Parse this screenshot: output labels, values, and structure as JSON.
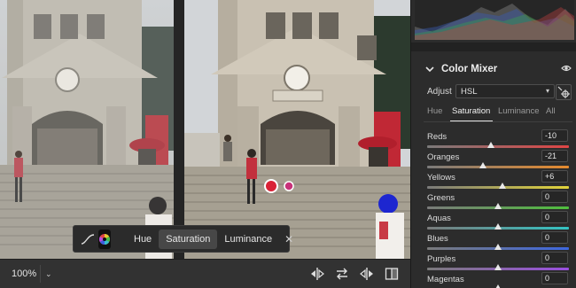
{
  "float_toolbar": {
    "curve_icon": "curve-icon",
    "color_icon": "color-wheel-icon",
    "tabs": [
      "Hue",
      "Saturation",
      "Luminance"
    ],
    "active_tab": "Saturation",
    "close_label": "✕"
  },
  "bottom_bar": {
    "zoom": "100%",
    "zoom_chevron": "⌄",
    "icons": [
      "compare-before-after-icon",
      "swap-icon",
      "copy-settings-icon",
      "split-view-icon"
    ]
  },
  "panel": {
    "section_title": "Color Mixer",
    "adjust_label": "Adjust",
    "adjust_value": "HSL",
    "adjust_caret": "▾",
    "mode_tabs": [
      "Hue",
      "Saturation",
      "Luminance",
      "All"
    ],
    "active_mode": "Saturation",
    "sliders": [
      {
        "label": "Reds",
        "value": "-10",
        "level": -10,
        "gradient": [
          "#7a7a7a",
          "#e04545"
        ]
      },
      {
        "label": "Oranges",
        "value": "-21",
        "level": -21,
        "gradient": [
          "#7a7a7a",
          "#e58a2e"
        ]
      },
      {
        "label": "Yellows",
        "value": "+6",
        "level": 6,
        "gradient": [
          "#7a7a7a",
          "#e2d43a"
        ]
      },
      {
        "label": "Greens",
        "value": "0",
        "level": 0,
        "gradient": [
          "#7a7a7a",
          "#4fbf3d"
        ]
      },
      {
        "label": "Aquas",
        "value": "0",
        "level": 0,
        "gradient": [
          "#7a7a7a",
          "#33c4c4"
        ]
      },
      {
        "label": "Blues",
        "value": "0",
        "level": 0,
        "gradient": [
          "#7a7a7a",
          "#3d67e0"
        ]
      },
      {
        "label": "Purples",
        "value": "0",
        "level": 0,
        "gradient": [
          "#7a7a7a",
          "#9a4fe0"
        ]
      },
      {
        "label": "Magentas",
        "value": "0",
        "level": 0,
        "gradient": [
          "#7a7a7a",
          "#e04fb5"
        ]
      }
    ]
  }
}
